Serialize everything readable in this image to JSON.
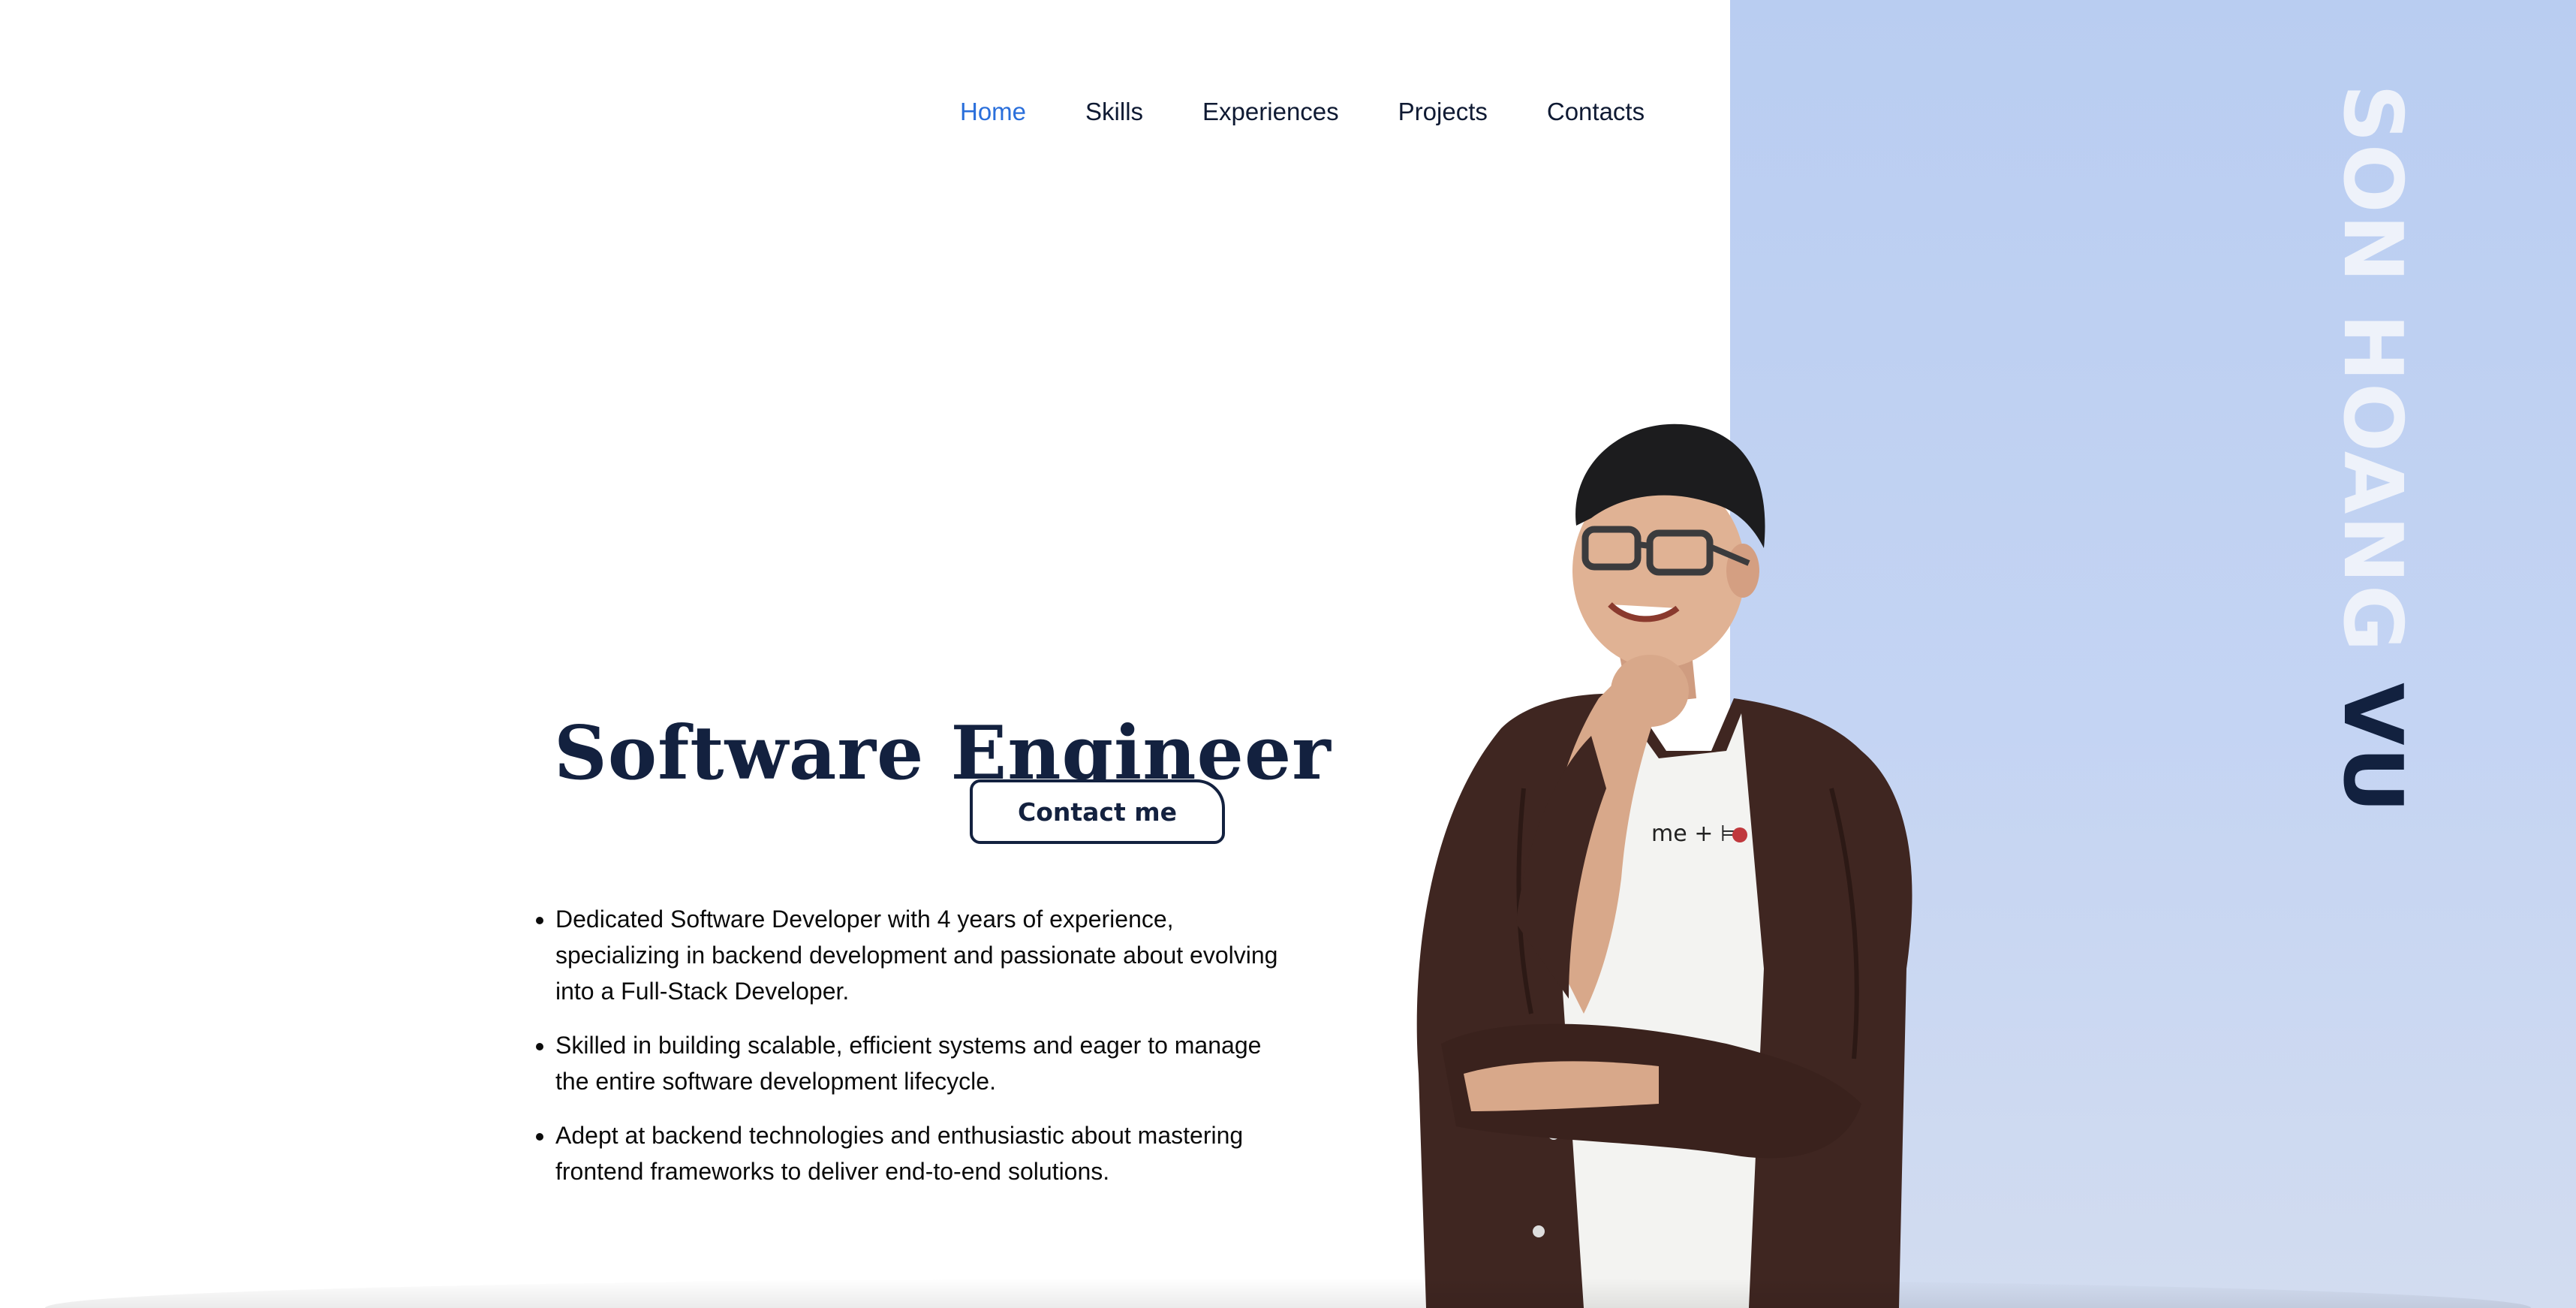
{
  "nav": {
    "items": [
      {
        "label": "Home",
        "active": true
      },
      {
        "label": "Skills",
        "active": false
      },
      {
        "label": "Experiences",
        "active": false
      },
      {
        "label": "Projects",
        "active": false
      },
      {
        "label": "Contacts",
        "active": false
      }
    ]
  },
  "hero": {
    "name_first": "SON HOANG",
    "name_last": "VU",
    "title": "Software Engineer",
    "contact_button": "Contact me",
    "bullets": [
      "Dedicated Software Developer with 4 years of experience, specializing in backend development and passionate about evolving into a Full-Stack Developer.",
      "Skilled in building scalable, efficient systems and eager to manage the entire software development lifecycle.",
      "Adept at backend technologies and enthusiastic about mastering frontend frameworks to deliver end-to-end solutions."
    ],
    "shirt_text": "me + ⊨"
  },
  "colors": {
    "accent": "#2a6fdb",
    "navy": "#13213f",
    "panel": "#b9cdf1"
  }
}
